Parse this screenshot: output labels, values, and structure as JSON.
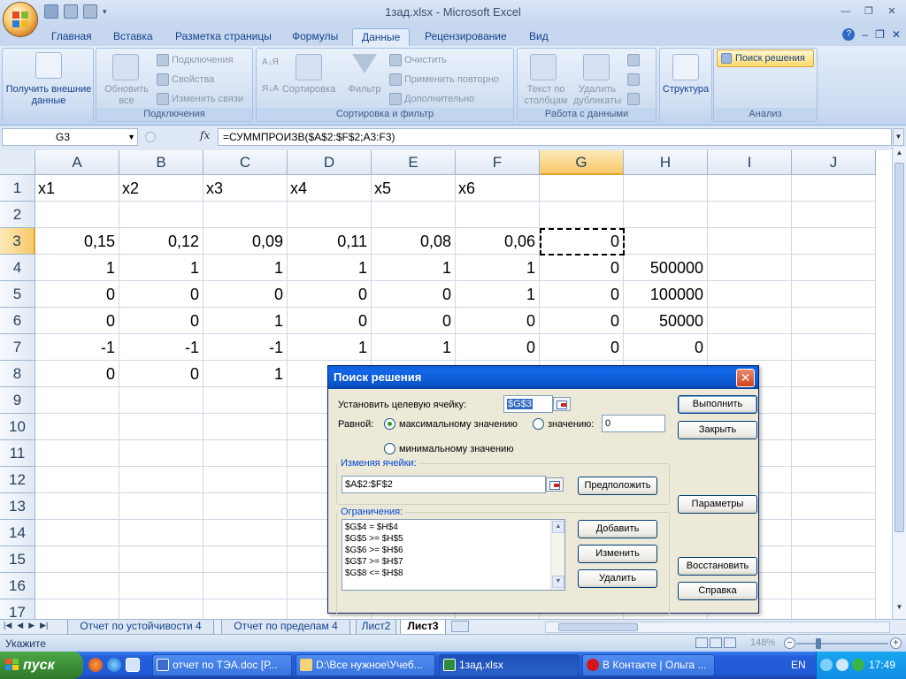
{
  "window": {
    "title": "1зад.xlsx - Microsoft Excel"
  },
  "ribbon_tabs": [
    {
      "label": "Главная"
    },
    {
      "label": "Вставка"
    },
    {
      "label": "Разметка страницы"
    },
    {
      "label": "Формулы"
    },
    {
      "label": "Данные",
      "active": true
    },
    {
      "label": "Рецензирование"
    },
    {
      "label": "Вид"
    }
  ],
  "ribbon": {
    "get_external": "Получить внешние данные",
    "refresh_all": "Обновить все",
    "connections": "Подключения",
    "properties": "Свойства",
    "edit_links": "Изменить связи",
    "group_connections": "Подключения",
    "sort": "Сортировка",
    "filter": "Фильтр",
    "clear": "Очистить",
    "reapply": "Применить повторно",
    "advanced": "Дополнительно",
    "group_sort_filter": "Сортировка и фильтр",
    "text_to_columns": "Текст по столбцам",
    "remove_duplicates": "Удалить дубликаты",
    "group_data_tools": "Работа с данными",
    "outline": "Структура",
    "solver": "Поиск решения",
    "group_analysis": "Анализ"
  },
  "formula_bar": {
    "name_box": "G3",
    "fx": "fx",
    "formula": "=СУММПРОИЗВ($A$2:$F$2;A3:F3)"
  },
  "columns": [
    "A",
    "B",
    "C",
    "D",
    "E",
    "F",
    "G",
    "H",
    "I",
    "J"
  ],
  "rows": [
    "1",
    "2",
    "3",
    "4",
    "5",
    "6",
    "7",
    "8",
    "9",
    "10",
    "11",
    "12",
    "13",
    "14",
    "15",
    "16",
    "17"
  ],
  "sheet": {
    "row1": [
      "x1",
      "x2",
      "x3",
      "x4",
      "x5",
      "x6"
    ],
    "row3": [
      "0,15",
      "0,12",
      "0,09",
      "0,11",
      "0,08",
      "0,06",
      "0"
    ],
    "row4": [
      "1",
      "1",
      "1",
      "1",
      "1",
      "1",
      "0",
      "500000"
    ],
    "row5": [
      "0",
      "0",
      "0",
      "0",
      "0",
      "1",
      "0",
      "100000"
    ],
    "row6": [
      "0",
      "0",
      "1",
      "0",
      "0",
      "0",
      "0",
      "50000"
    ],
    "row7": [
      "-1",
      "-1",
      "-1",
      "1",
      "1",
      "0",
      "0",
      "0"
    ],
    "row8": [
      "0",
      "0",
      "1"
    ]
  },
  "sheet_tabs": [
    {
      "label": "Отчет по устойчивости 4"
    },
    {
      "label": "Отчет по пределам 4"
    },
    {
      "label": "Лист2"
    },
    {
      "label": "Лист3",
      "active": true
    }
  ],
  "status": {
    "mode": "Укажите",
    "zoom": "148%"
  },
  "solver_dialog": {
    "title": "Поиск решения",
    "target_label": "Установить целевую ячейку:",
    "target_value": "$G$3",
    "equal_label": "Равной:",
    "max_label": "максимальному значению",
    "value_label": "значению:",
    "value_input": "0",
    "min_label": "минимальному значению",
    "changing_legend": "Изменяя ячейки:",
    "changing_value": "$A$2:$F$2",
    "guess": "Предположить",
    "constraints_legend": "Ограничения:",
    "constraints": [
      "$G$4 = $H$4",
      "$G$5 >= $H$5",
      "$G$6 >= $H$6",
      "$G$7 >= $H$7",
      "$G$8 <= $H$8"
    ],
    "add": "Добавить",
    "change": "Изменить",
    "delete": "Удалить",
    "solve": "Выполнить",
    "close": "Закрыть",
    "options": "Параметры",
    "reset": "Восстановить",
    "help": "Справка"
  },
  "taskbar": {
    "start": "пуск",
    "tasks": [
      {
        "label": "отчет по ТЭА.doc [Р..."
      },
      {
        "label": "D:\\Все нужное\\Учеб..."
      },
      {
        "label": "1зад.xlsx",
        "active": true
      },
      {
        "label": "В Контакте | Ольга ..."
      }
    ],
    "lang": "EN",
    "clock": "17:49"
  }
}
